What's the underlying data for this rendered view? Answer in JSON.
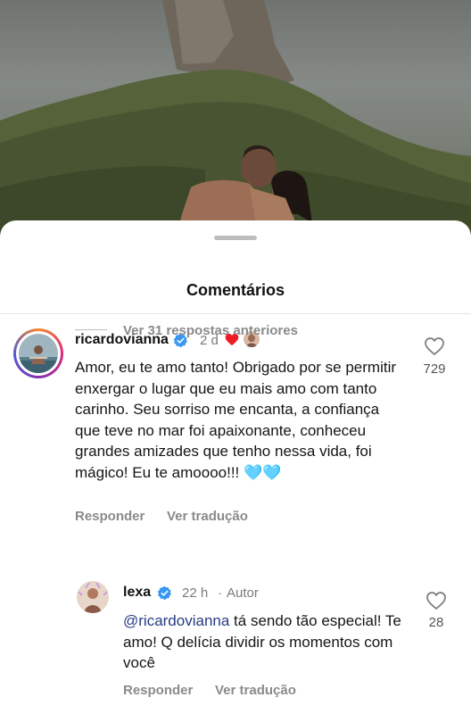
{
  "sheet": {
    "title": "Comentários"
  },
  "comments": [
    {
      "username": "ricardovianna",
      "time": "2 d",
      "text": "Amor, eu te amo tanto! Obrigado por se permitir enxergar o lugar que eu mais amo com tanto carinho. Seu sorriso me encanta, a confiança que teve no mar foi apaixonante, conheceu grandes amizades que tenho nessa vida, foi mágico! Eu te amoooo!!!",
      "emoji": "🩵🩵",
      "likes": "729",
      "reply_label": "Responder",
      "translate_label": "Ver tradução"
    }
  ],
  "replies_toggle": "Ver 31 respostas anteriores",
  "reply": {
    "username": "lexa",
    "time": "22 h",
    "author_tag": "Autor",
    "mention": "@ricardovianna",
    "text": " tá sendo tão especial! Te amo! Q delícia dividir os momentos com você",
    "likes": "28",
    "reply_label": "Responder",
    "translate_label": "Ver tradução"
  },
  "colors": {
    "verified": "#3897f0",
    "heart_reaction": "#ed1c24",
    "mention": "#263b83"
  },
  "icons": {
    "like": "heart-outline-icon",
    "verified": "verified-badge-icon",
    "reaction": "red-heart-icon"
  }
}
